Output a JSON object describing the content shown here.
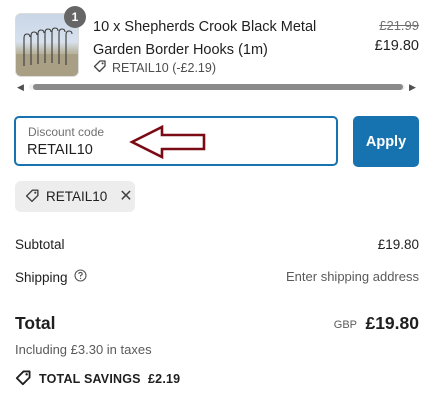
{
  "product": {
    "quantity": "1",
    "title": "10 x Shepherds Crook Black Metal Garden Border Hooks (1m)",
    "discount_line": "RETAIL10 (-£2.19)",
    "original_price": "£21.99",
    "price": "£19.80",
    "image_icon": "garden-hooks-product-image"
  },
  "discount": {
    "label": "Discount code",
    "value": "RETAIL10",
    "apply_label": "Apply",
    "applied_code": "RETAIL10",
    "remove_icon": "close-icon"
  },
  "summary": {
    "subtotal_label": "Subtotal",
    "subtotal_value": "£19.80",
    "shipping_label": "Shipping",
    "shipping_value": "Enter shipping address",
    "total_label": "Total",
    "currency": "GBP",
    "total_value": "£19.80",
    "taxes_note": "Including £3.30 in taxes",
    "savings_text": "TOTAL SAVINGS  £2.19"
  },
  "colors": {
    "accent": "#1773b0",
    "annotation_arrow": "#7a0a14",
    "badge": "#666666"
  }
}
